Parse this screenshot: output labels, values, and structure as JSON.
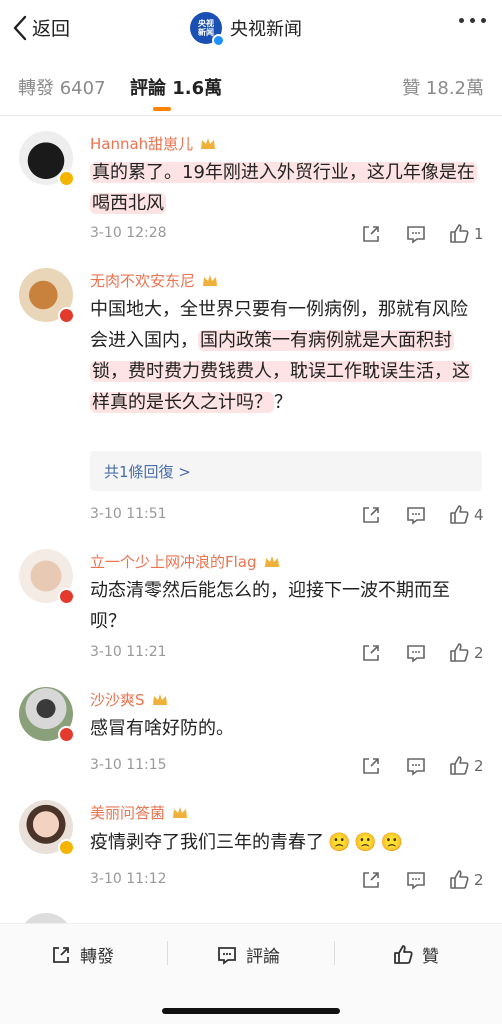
{
  "nav": {
    "back_label": "返回",
    "logo_text": "央视新闻",
    "title": "央视新闻"
  },
  "tabs": {
    "repost": "轉發 6407",
    "comment": "評論 1.6萬",
    "like": "贊 18.2萬"
  },
  "colors": {
    "accent": "#ff8200",
    "username": "#eb7350",
    "highlight": "#fde3e3",
    "reply_link": "#4a6ea8"
  },
  "comments": [
    {
      "username": "Hannah甜崽儿",
      "text": "真的累了。19年刚进入外贸行业，这几年像是在喝西北风",
      "date": "3-10 12:28",
      "likes": "1"
    },
    {
      "username": "无肉不欢安东尼",
      "text_plain": "中国地大，全世界只要有一例病例，那就有风险会进入国内，",
      "text_highlight": "国内政策一有病例就是大面积封锁，费时费力费钱费人，耽误工作耽误生活，这样真的是长久之计吗？",
      "text_tail": "？",
      "replies": "共1條回復 >",
      "date": "3-10 11:51",
      "likes": "4"
    },
    {
      "username": "立一个少上网冲浪的Flag",
      "text": "动态清零然后能怎么的，迎接下一波不期而至呗？",
      "date": "3-10 11:21",
      "likes": "2"
    },
    {
      "username": "沙沙爽S",
      "text": "感冒有啥好防的。",
      "date": "3-10 11:15",
      "likes": "2"
    },
    {
      "username": "美丽问答菌",
      "text": "疫情剥夺了我们三年的青春了",
      "emojis": "🙁🙁🙁",
      "date": "3-10 11:12",
      "likes": "2"
    }
  ],
  "bottombar": {
    "repost": "轉發",
    "comment": "評論",
    "like": "贊"
  }
}
